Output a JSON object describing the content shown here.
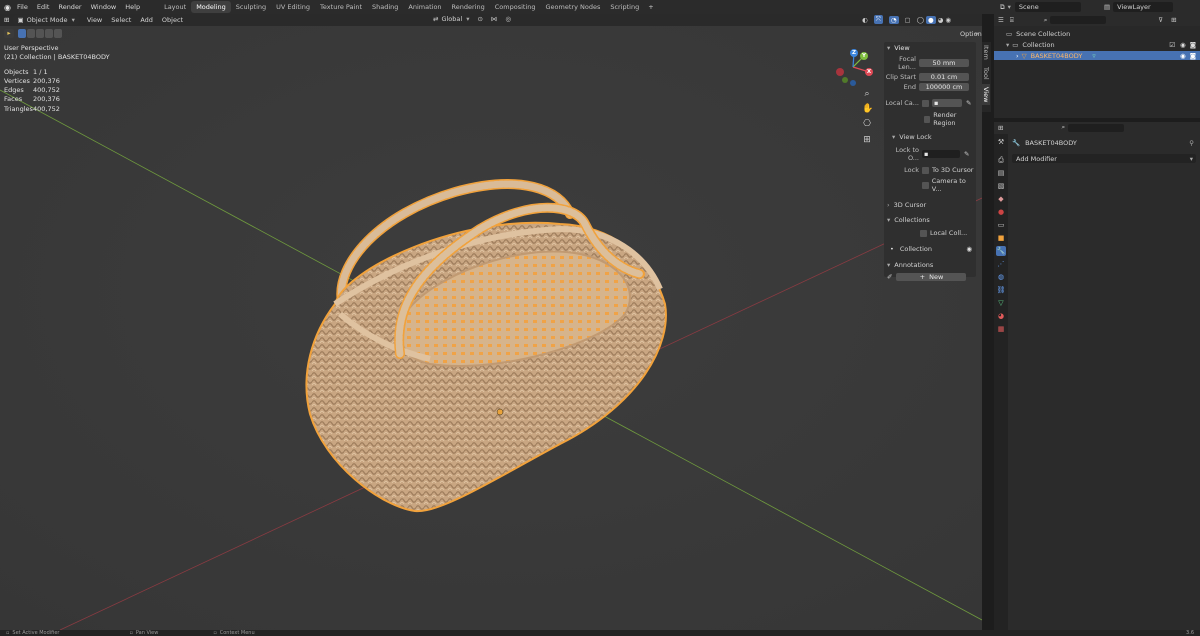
{
  "menu": {
    "items": [
      "File",
      "Edit",
      "Render",
      "Window",
      "Help"
    ]
  },
  "workspaces": {
    "tabs": [
      "Layout",
      "Modeling",
      "Sculpting",
      "UV Editing",
      "Texture Paint",
      "Shading",
      "Animation",
      "Rendering",
      "Compositing",
      "Geometry Nodes",
      "Scripting"
    ],
    "active": "Modeling",
    "add_symbol": "+"
  },
  "scene": {
    "label": "Scene",
    "view_layer": "ViewLayer"
  },
  "viewport": {
    "mode": "Object Mode",
    "menus": [
      "View",
      "Select",
      "Add",
      "Object"
    ],
    "transform_orientation": "Global",
    "options_label": "Options",
    "perspective_label": "User Perspective",
    "collection_line": "(21) Collection | BASKET04BODY",
    "stats": [
      {
        "key": "Objects",
        "value": "1 / 1"
      },
      {
        "key": "Vertices",
        "value": "200,376"
      },
      {
        "key": "Edges",
        "value": "400,752"
      },
      {
        "key": "Faces",
        "value": "200,376"
      },
      {
        "key": "Triangles",
        "value": "400,752"
      }
    ],
    "gizmo": {
      "x": "X",
      "y": "Y",
      "z": "Z"
    }
  },
  "npanel": {
    "view_header": "View",
    "focal_label": "Focal Len...",
    "focal_value": "50 mm",
    "clip_start_label": "Clip Start",
    "clip_start_value": "0.01 cm",
    "end_label": "End",
    "end_value": "100000 cm",
    "local_camera_label": "Local Ca...",
    "render_region_label": "Render Region",
    "view_lock_header": "View Lock",
    "lock_to_object_label": "Lock to O...",
    "lock_label": "Lock",
    "to_3d_cursor_label": "To 3D Cursor",
    "camera_to_view_label": "Camera to V...",
    "cursor_header": "3D Cursor",
    "collections_header": "Collections",
    "local_collections_label": "Local Coll...",
    "collection_item": "Collection",
    "annotations_header": "Annotations",
    "new_label": "New",
    "tabs": [
      "Item",
      "Tool",
      "View"
    ]
  },
  "outliner": {
    "scene_collection": "Scene Collection",
    "collection": "Collection",
    "object": "BASKET04BODY"
  },
  "properties": {
    "object_name": "BASKET04BODY",
    "add_modifier": "Add Modifier"
  },
  "statusbar": {
    "items": [
      "Set Active Modifier",
      "Pan View",
      "Context Menu"
    ],
    "version": "3.6"
  },
  "colors": {
    "accent_blue": "#4772b3",
    "selection_orange": "#f1a23c",
    "basket": "#cfae8a",
    "axis_x": "#e04a56",
    "axis_y": "#7fbf3f",
    "axis_z": "#3d86df"
  }
}
